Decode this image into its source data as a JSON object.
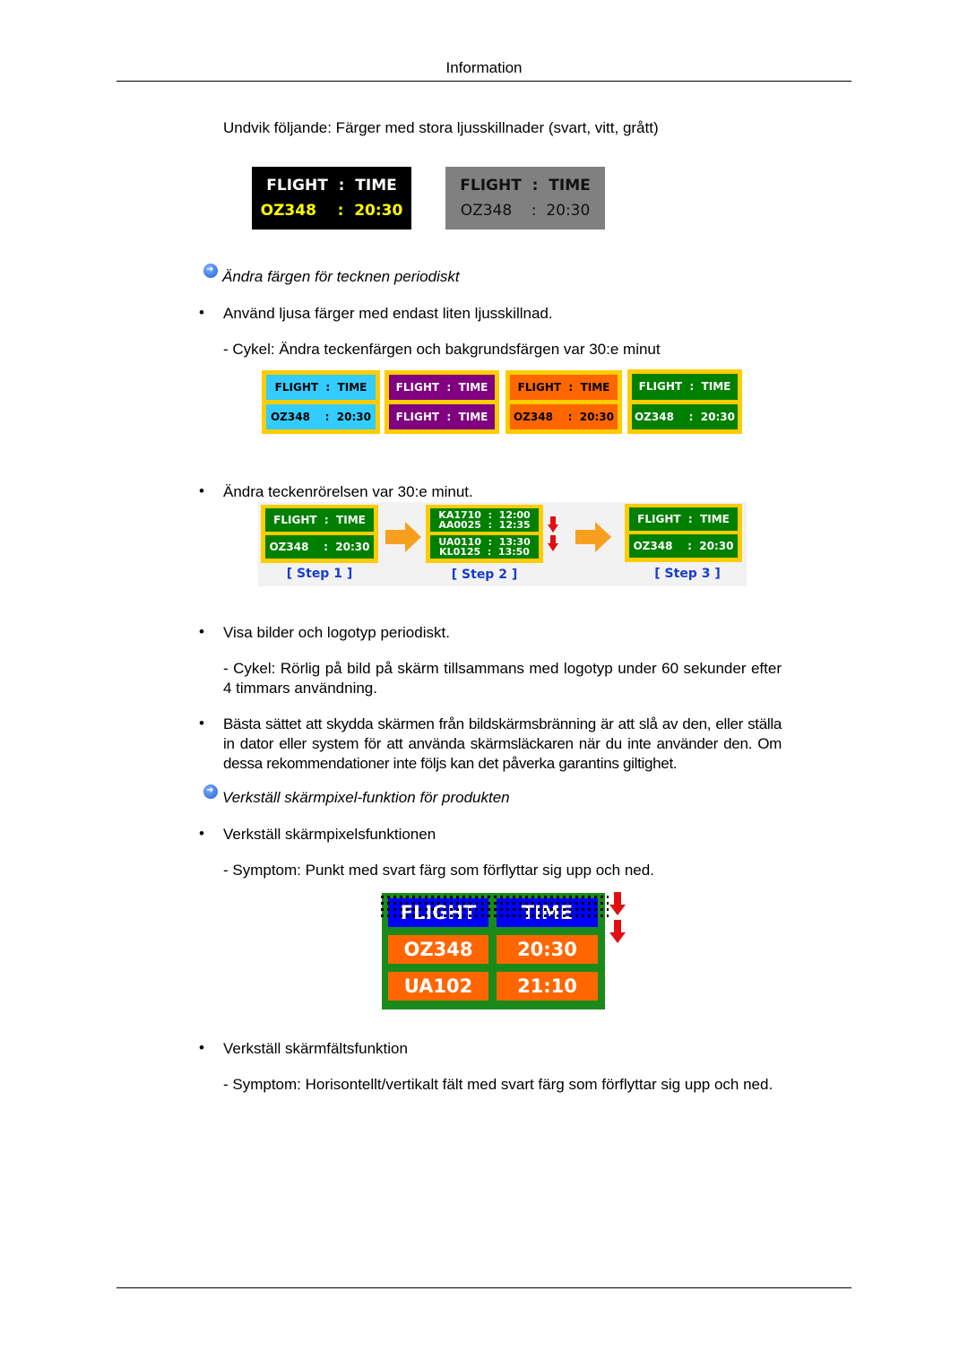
{
  "header": {
    "title": "Information"
  },
  "intro": "Undvik följande: Färger med stora ljusskillnader (svart, vitt, grått)",
  "contrast_examples": [
    {
      "row1": "FLIGHT  :  TIME",
      "row2": "OZ348    :  20:30",
      "bg": "#000000",
      "row1_color": "#ffffff",
      "row2_color": "#ffff00"
    },
    {
      "row1": "FLIGHT  :  TIME",
      "row2": "OZ348    :  20:30",
      "bg": "#808080",
      "row1_color": "#111111",
      "row2_color": "#111111"
    }
  ],
  "section1": {
    "icon": "arrow-circle-icon",
    "title": "Ändra färgen för tecknen periodiskt",
    "bullet1": "Använd ljusa färger med endast liten ljusskillnad.",
    "sub1": "- Cykel: Ändra teckenfärgen och bakgrundsfärgen var 30:e minut",
    "cycle_boards": [
      {
        "row1": "FLIGHT  :  TIME",
        "row2": "OZ348    :  20:30",
        "bg": "#33ccff",
        "fg": "#000000"
      },
      {
        "row1": "FLIGHT  :  TIME",
        "row2": "FLIGHT  :  TIME",
        "bg": "#800080",
        "fg": "#ffffff"
      },
      {
        "row1": "FLIGHT  :  TIME",
        "row2": "OZ348    :  20:30",
        "bg": "#ff6600",
        "fg": "#000000"
      },
      {
        "row1": "FLIGHT  :  TIME",
        "row2": "OZ348    :  20:30",
        "bg": "#008000",
        "fg": "#ffffff"
      }
    ],
    "bullet2": "Ändra teckenrörelsen var 30:e minut.",
    "steps": [
      {
        "label": "[  Step 1  ]",
        "row1": "FLIGHT  :  TIME",
        "row2": "OZ348    :  20:30"
      },
      {
        "label": "[  Step 2  ]",
        "row1a": "KA1710  :  12:00",
        "row1b": "AA0025  :  12:35",
        "row2a": "UA0110  :  13:30",
        "row2b": "KL0125  :  13:50"
      },
      {
        "label": "[  Step 3  ]",
        "row1": "FLIGHT  :  TIME",
        "row2": "OZ348    :  20:30"
      }
    ],
    "bullet3": "Visa bilder och logotyp periodiskt.",
    "sub3": "- Cykel: Rörlig på bild på skärm tillsammans med logotyp under 60 sekunder efter 4 timmars användning.",
    "bullet4": "Bästa sättet att skydda skärmen från bildskärmsbränning är att slå av den, eller ställa in dator eller system för att använda skärmsläckaren när du inte använder den. Om dessa rekommendationer inte följs kan det påverka garantins giltighet."
  },
  "section2": {
    "icon": "arrow-circle-icon",
    "title": "Verkställ skärmpixel-funktion för produkten",
    "bullet1": "Verkställ skärmpixelsfunktionen",
    "sub1": "- Symptom: Punkt med svart färg som förflyttar sig upp och ned.",
    "pixel_board": {
      "header": [
        "FLIGHT",
        "TIME"
      ],
      "rows": [
        [
          "OZ348",
          "20:30"
        ],
        [
          "UA102",
          "21:10"
        ]
      ]
    },
    "bullet2": "Verkställ skärmfältsfunktion",
    "sub2": "- Symptom: Horisontellt/vertikalt fält med svart färg som förflyttar sig upp och ned."
  },
  "bullet_char": "•"
}
